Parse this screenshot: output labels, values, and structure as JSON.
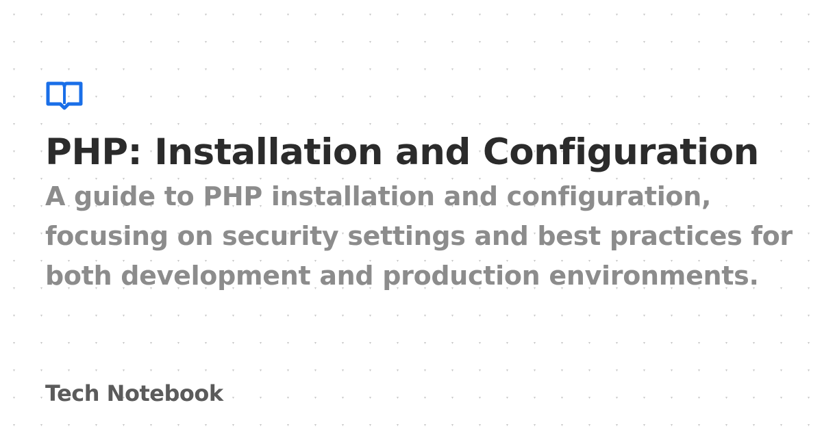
{
  "brand": {
    "accent": "#1a6fe8",
    "icon": "book-icon"
  },
  "article": {
    "title": "PHP: Installation and Configuration",
    "description": "A guide to PHP installation and configuration, focusing on security settings and best practices for both development and production environments."
  },
  "site": {
    "name": "Tech Notebook"
  }
}
